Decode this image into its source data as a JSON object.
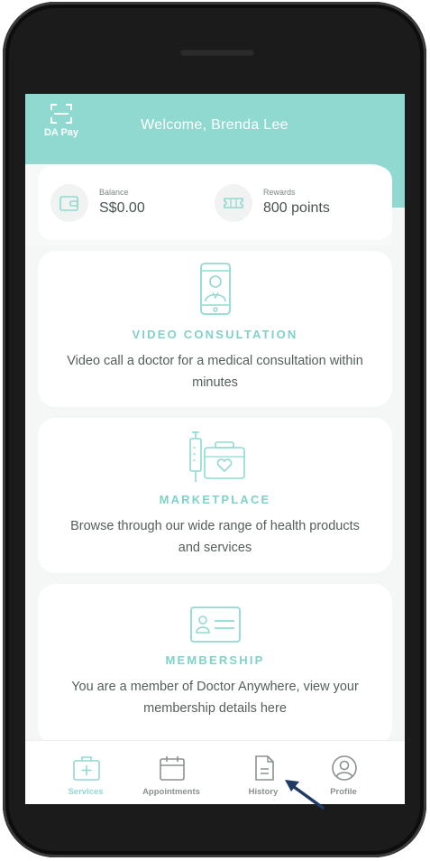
{
  "header": {
    "da_pay_label": "DA Pay",
    "welcome_text": "Welcome, Brenda Lee"
  },
  "wallet": {
    "balance_label": "Balance",
    "balance_value": "S$0.00",
    "rewards_label": "Rewards",
    "rewards_value": "800 points"
  },
  "services": [
    {
      "icon": "doctor-phone-icon",
      "title": "VIDEO CONSULTATION",
      "description": "Video call a doctor for a medical consultation within minutes"
    },
    {
      "icon": "medical-bag-syringe-icon",
      "title": "MARKETPLACE",
      "description": "Browse through our wide range of health products and services"
    },
    {
      "icon": "membership-card-icon",
      "title": "MEMBERSHIP",
      "description": "You are a member of Doctor Anywhere, view your membership details here"
    }
  ],
  "tabbar": {
    "items": [
      {
        "label": "Services",
        "icon": "medical-kit-icon",
        "active": true
      },
      {
        "label": "Appointments",
        "icon": "calendar-icon",
        "active": false
      },
      {
        "label": "History",
        "icon": "document-icon",
        "active": false
      },
      {
        "label": "Profile",
        "icon": "user-circle-icon",
        "active": false
      }
    ]
  },
  "colors": {
    "accent": "#8fd9d1",
    "accent_text": "#7fd2c8",
    "body_text": "#555d5d",
    "arrow": "#1f3a63"
  }
}
